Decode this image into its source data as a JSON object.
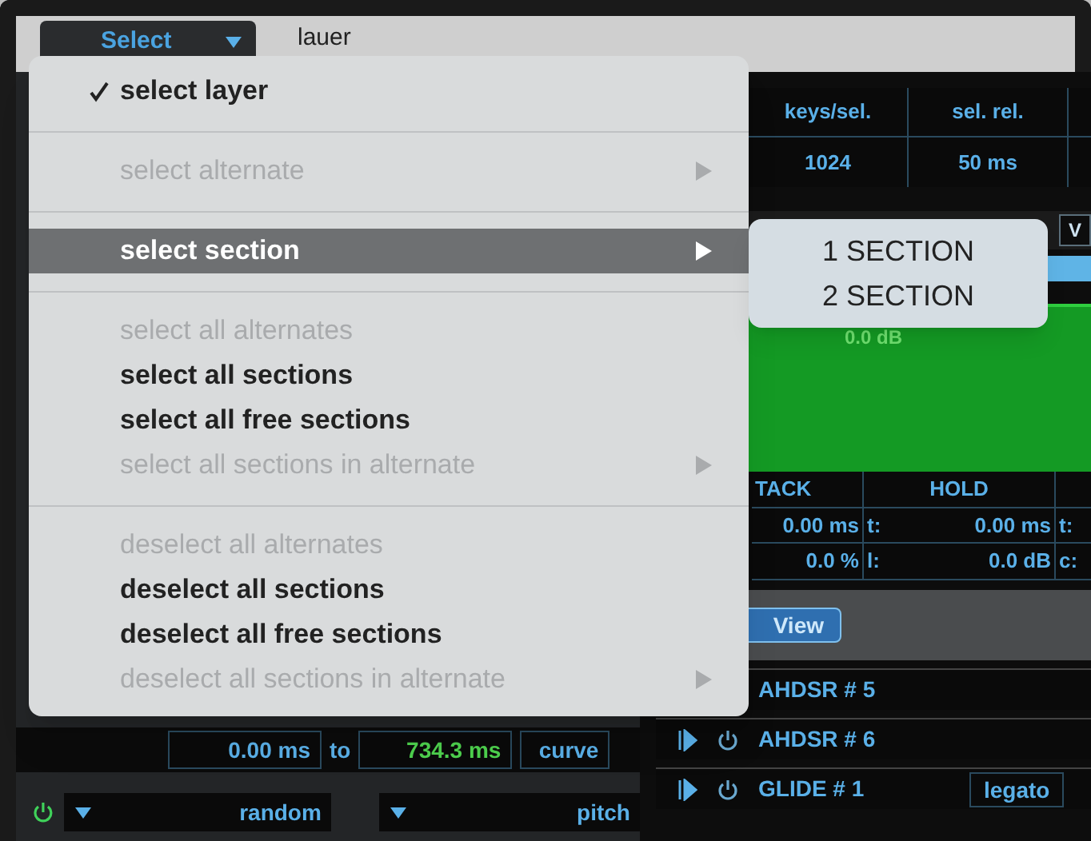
{
  "toolbar": {
    "select_button": "Select",
    "layer_label": "lauer"
  },
  "info_table": {
    "columns": [
      "keys/sel.",
      "sel. rel."
    ],
    "values": [
      "1024",
      "50 ms"
    ]
  },
  "tab_label": "V",
  "level_display": "0.0 dB",
  "envelope": {
    "columns": [
      "TACK",
      "HOLD"
    ],
    "rows": [
      [
        "0.00 ms",
        "t:",
        "0.00 ms",
        "t:"
      ],
      [
        "0.0 %",
        "l:",
        "0.0 dB",
        "c:"
      ]
    ]
  },
  "view_button": "View",
  "modulators": [
    {
      "name": "AHDSR # 5"
    },
    {
      "name": "AHDSR # 6"
    },
    {
      "name": "GLIDE # 1",
      "option": "legato"
    }
  ],
  "time_range": {
    "from": "0.00 ms",
    "to_label": "to",
    "to": "734.3 ms",
    "curve": "curve"
  },
  "source_row": {
    "power_on": true,
    "source": "random",
    "target": "pitch"
  },
  "menu": {
    "items": [
      {
        "kind": "item",
        "label": "select layer",
        "checked": true,
        "disabled": false,
        "selected": false,
        "submenu": false
      },
      {
        "kind": "separator"
      },
      {
        "kind": "item",
        "label": "select alternate",
        "checked": false,
        "disabled": true,
        "selected": false,
        "submenu": true
      },
      {
        "kind": "separator"
      },
      {
        "kind": "item",
        "label": "select section",
        "checked": false,
        "disabled": false,
        "selected": true,
        "submenu": true
      },
      {
        "kind": "separator"
      },
      {
        "kind": "item",
        "label": "select all alternates",
        "checked": false,
        "disabled": true,
        "selected": false,
        "submenu": false
      },
      {
        "kind": "item",
        "label": "select all sections",
        "checked": false,
        "disabled": false,
        "selected": false,
        "submenu": false
      },
      {
        "kind": "item",
        "label": "select all free sections",
        "checked": false,
        "disabled": false,
        "selected": false,
        "submenu": false
      },
      {
        "kind": "item",
        "label": "select all sections in alternate",
        "checked": false,
        "disabled": true,
        "selected": false,
        "submenu": true
      },
      {
        "kind": "separator"
      },
      {
        "kind": "item",
        "label": "deselect all alternates",
        "checked": false,
        "disabled": true,
        "selected": false,
        "submenu": false
      },
      {
        "kind": "item",
        "label": "deselect all sections",
        "checked": false,
        "disabled": false,
        "selected": false,
        "submenu": false
      },
      {
        "kind": "item",
        "label": "deselect all free sections",
        "checked": false,
        "disabled": false,
        "selected": false,
        "submenu": false
      },
      {
        "kind": "item",
        "label": "deselect all sections in alternate",
        "checked": false,
        "disabled": true,
        "selected": false,
        "submenu": true
      }
    ]
  },
  "submenu": {
    "items": [
      "1 SECTION",
      "2 SECTION"
    ]
  }
}
